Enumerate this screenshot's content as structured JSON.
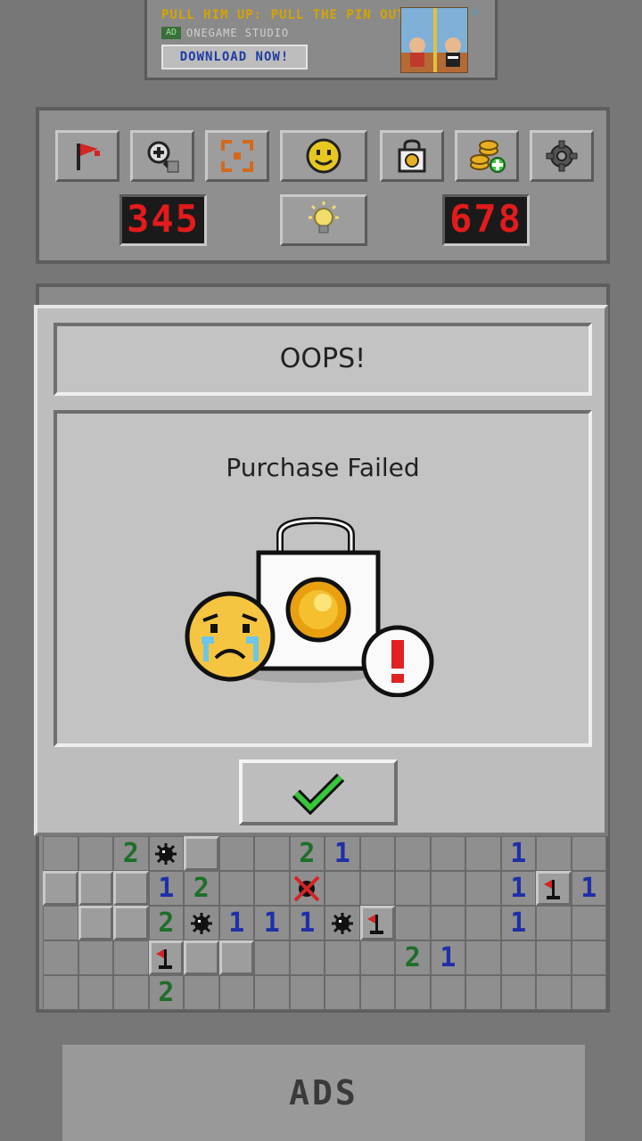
{
  "ad": {
    "title": "PULL HIM UP: PULL THE PIN OUT",
    "badge": "AD",
    "studio": "ONEGAME STUDIO",
    "download_label": "DOWNLOAD NOW!",
    "choice_icon": "ad-choices-icon"
  },
  "toolbar": {
    "buttons": [
      {
        "name": "flag-button",
        "icon": "flag-icon"
      },
      {
        "name": "zoom-button",
        "icon": "zoom-in-icon"
      },
      {
        "name": "fullscreen-button",
        "icon": "fullscreen-icon"
      },
      {
        "name": "face-button",
        "icon": "smiley-face-icon"
      },
      {
        "name": "shop-button",
        "icon": "shopping-bag-icon"
      },
      {
        "name": "coins-button",
        "icon": "add-coins-icon"
      },
      {
        "name": "settings-button",
        "icon": "gear-icon"
      }
    ],
    "mines_counter": "345",
    "timer": "678",
    "hint_icon": "lightbulb-icon"
  },
  "dialog": {
    "title": "OOPS!",
    "message": "Purchase Failed",
    "illustration": [
      "crying-face-icon",
      "shopping-bag-coin-icon",
      "exclamation-icon"
    ],
    "ok_icon": "checkmark-icon"
  },
  "board": {
    "rows": [
      [
        "",
        "",
        "2",
        "*",
        "#",
        "",
        "",
        "2",
        "1",
        "",
        "",
        "",
        "",
        "1",
        "",
        ""
      ],
      [
        "#",
        "#",
        "#",
        "1",
        "2",
        "",
        "",
        "X",
        "",
        "",
        "",
        "",
        "",
        "1",
        "F",
        "1"
      ],
      [
        "",
        "#",
        "#",
        "2",
        "*",
        "1",
        "1",
        "1",
        "*",
        "F",
        "",
        "",
        "",
        "1",
        "",
        ""
      ],
      [
        "",
        "",
        "",
        "F",
        "#",
        "#",
        "",
        "",
        "",
        "",
        "2",
        "1",
        "",
        "",
        "",
        ""
      ],
      [
        "",
        "",
        "",
        "2",
        "",
        "",
        "",
        "",
        "",
        "",
        "",
        "",
        "",
        "",
        "",
        ""
      ]
    ]
  },
  "bottom_ads": {
    "label": "ADS"
  },
  "colors": {
    "led": "#e31b1b",
    "number1": "#1f2fa8",
    "number2": "#1f6e2a",
    "checkmark": "#37c83a",
    "ad_title": "#d6a400"
  }
}
